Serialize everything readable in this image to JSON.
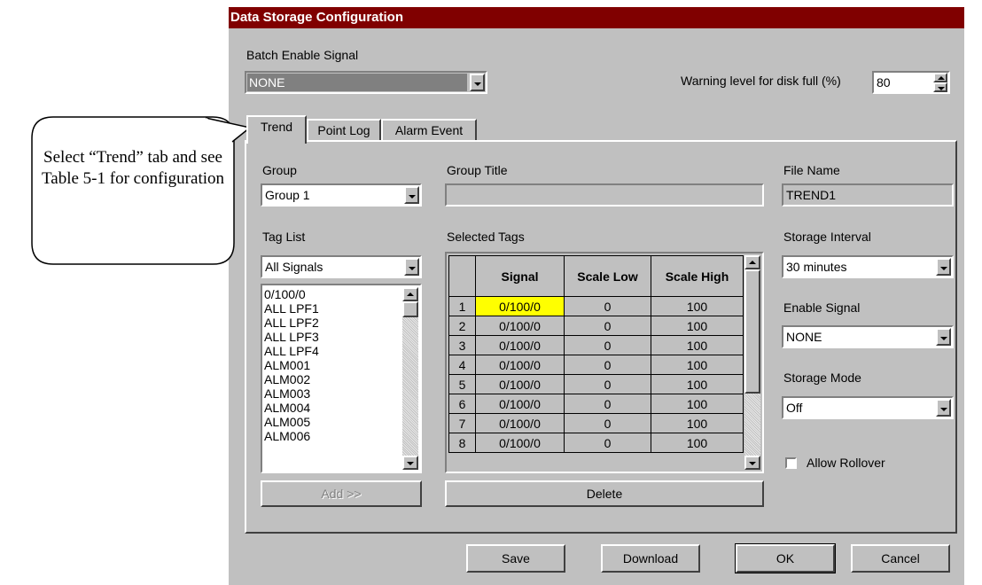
{
  "window": {
    "title": "Data Storage Configuration"
  },
  "batch_enable": {
    "label": "Batch Enable Signal",
    "value": "NONE"
  },
  "disk_warning": {
    "label": "Warning level for disk full (%)",
    "value": "80"
  },
  "tabs": [
    {
      "label": "Trend"
    },
    {
      "label": "Point Log"
    },
    {
      "label": "Alarm Event"
    }
  ],
  "callout": {
    "text": "Select “Trend” tab and see Table 5-1 for configuration"
  },
  "group": {
    "label": "Group",
    "value": "Group 1"
  },
  "group_title": {
    "label": "Group Title",
    "value": ""
  },
  "file_name": {
    "label": "File Name",
    "value": "TREND1"
  },
  "tag_list": {
    "label": "Tag List",
    "filter": "All Signals",
    "items": [
      "0/100/0",
      "ALL LPF1",
      "ALL LPF2",
      "ALL LPF3",
      "ALL LPF4",
      "ALM001",
      "ALM002",
      "ALM003",
      "ALM004",
      "ALM005",
      "ALM006"
    ]
  },
  "selected_tags": {
    "label": "Selected Tags",
    "columns": [
      "",
      "Signal",
      "Scale Low",
      "Scale High"
    ],
    "rows": [
      {
        "n": "1",
        "signal": "0/100/0",
        "low": "0",
        "high": "100"
      },
      {
        "n": "2",
        "signal": "0/100/0",
        "low": "0",
        "high": "100"
      },
      {
        "n": "3",
        "signal": "0/100/0",
        "low": "0",
        "high": "100"
      },
      {
        "n": "4",
        "signal": "0/100/0",
        "low": "0",
        "high": "100"
      },
      {
        "n": "5",
        "signal": "0/100/0",
        "low": "0",
        "high": "100"
      },
      {
        "n": "6",
        "signal": "0/100/0",
        "low": "0",
        "high": "100"
      },
      {
        "n": "7",
        "signal": "0/100/0",
        "low": "0",
        "high": "100"
      },
      {
        "n": "8",
        "signal": "0/100/0",
        "low": "0",
        "high": "100"
      }
    ]
  },
  "storage_interval": {
    "label": "Storage Interval",
    "value": "30 minutes"
  },
  "enable_signal": {
    "label": "Enable Signal",
    "value": "NONE"
  },
  "storage_mode": {
    "label": "Storage Mode",
    "value": "Off"
  },
  "allow_rollover": {
    "label": "Allow Rollover",
    "checked": false
  },
  "buttons": {
    "add": "Add >>",
    "delete": "Delete",
    "save": "Save",
    "download": "Download",
    "ok": "OK",
    "cancel": "Cancel"
  },
  "colors": {
    "title_bar": "#800000",
    "dialog": "#c0c0c0",
    "highlight_cell": "#ffff00"
  }
}
